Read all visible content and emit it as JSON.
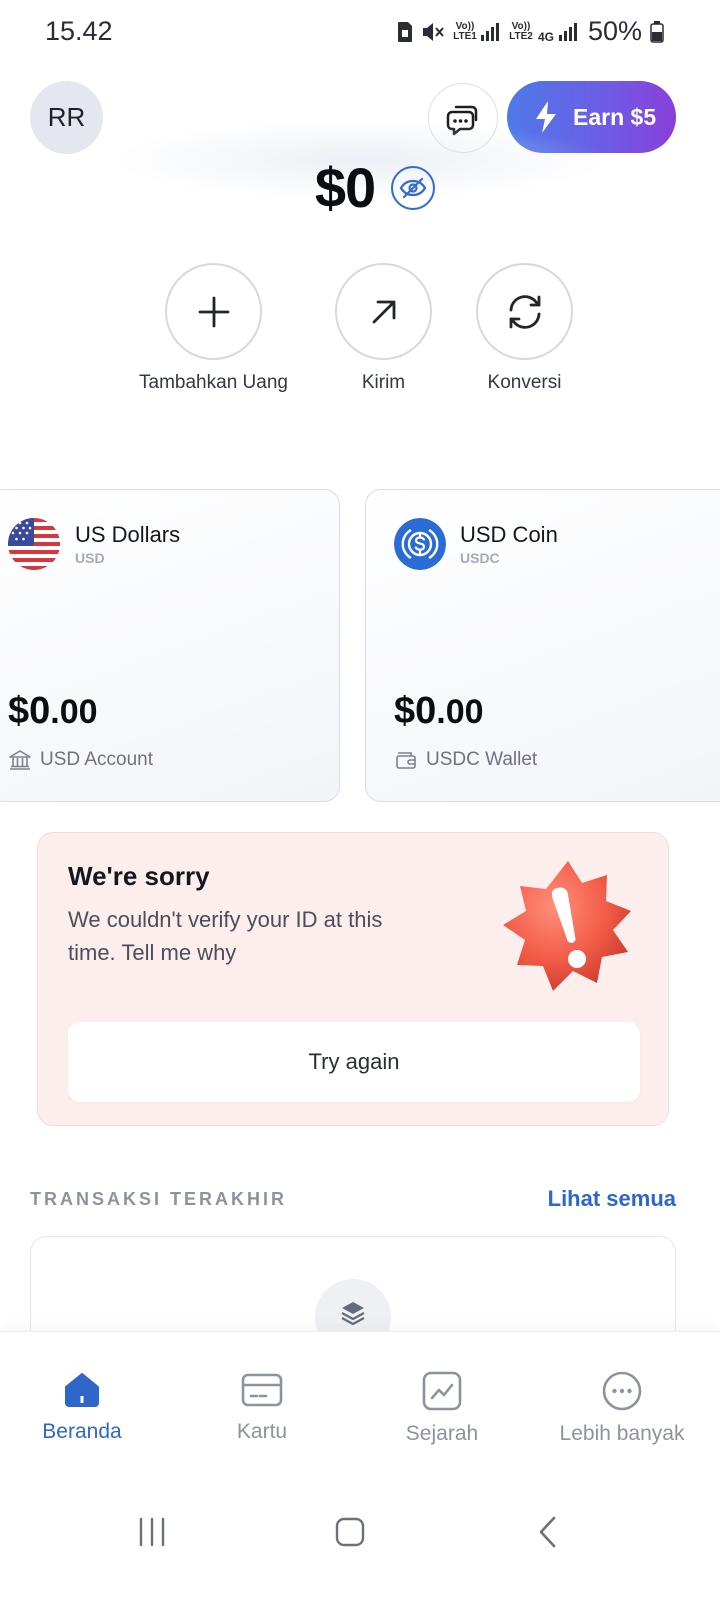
{
  "status_bar": {
    "time": "15.42",
    "sim1_label": "Vo)) LTE1",
    "sim2_label": "Vo)) LTE2",
    "network": "4G",
    "battery": "50%"
  },
  "header": {
    "avatar_initials": "RR",
    "earn_label": "Earn $5"
  },
  "balance": {
    "amount": "$0"
  },
  "actions": [
    {
      "label": "Tambahkan Uang",
      "icon": "plus-icon"
    },
    {
      "label": "Kirim",
      "icon": "arrow-up-right-icon"
    },
    {
      "label": "Konversi",
      "icon": "refresh-icon"
    }
  ],
  "accounts": [
    {
      "name": "US Dollars",
      "code": "USD",
      "balance_main": "$0",
      "balance_cents": ".00",
      "subtitle": "USD Account",
      "icon": "us-flag-icon"
    },
    {
      "name": "USD Coin",
      "code": "USDC",
      "balance_main": "$0",
      "balance_cents": ".00",
      "subtitle": "USDC Wallet",
      "icon": "usdc-coin-icon"
    }
  ],
  "alert": {
    "title": "We're sorry",
    "message": "We couldn't verify your ID at this time. Tell me why",
    "button": "Try again"
  },
  "transactions": {
    "heading": "TRANSAKSI TERAKHIR",
    "see_all": "Lihat semua"
  },
  "bottom_nav": [
    {
      "label": "Beranda",
      "icon": "home-icon",
      "active": true
    },
    {
      "label": "Kartu",
      "icon": "card-icon",
      "active": false
    },
    {
      "label": "Sejarah",
      "icon": "chart-icon",
      "active": false
    },
    {
      "label": "Lebih banyak",
      "icon": "more-icon",
      "active": false
    }
  ],
  "colors": {
    "accent": "#2f66c9",
    "alert_bg": "#fdeeee",
    "earn_gradient_start": "#4e7ae8",
    "earn_gradient_end": "#8a3fd9"
  }
}
